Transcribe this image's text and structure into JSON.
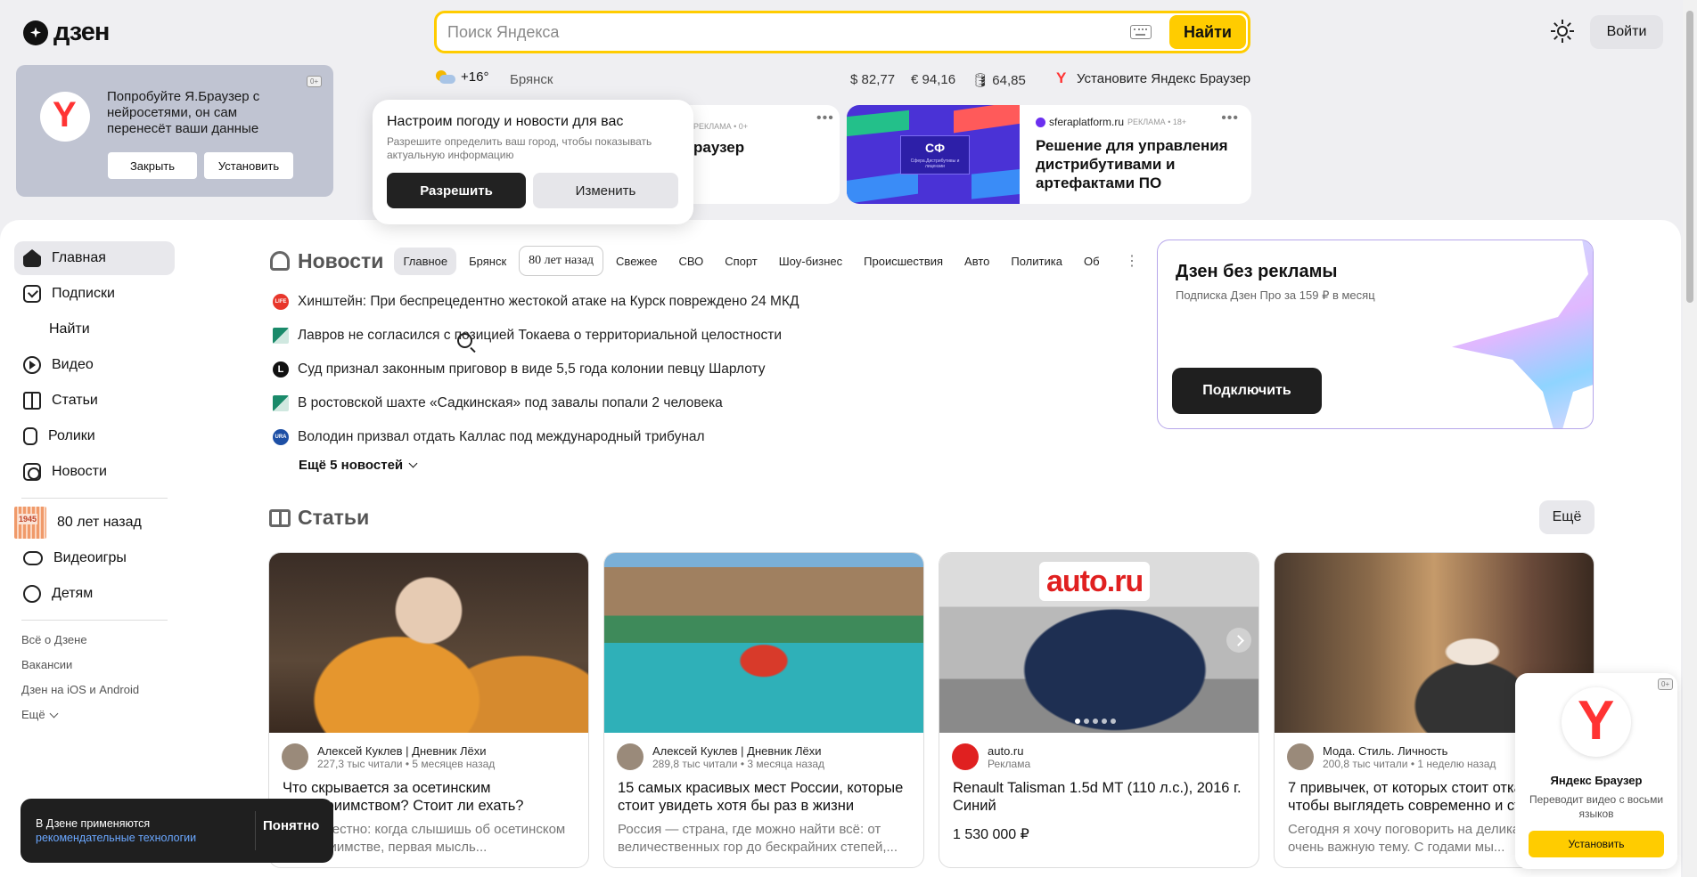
{
  "header": {
    "logo_text": "дзен",
    "search_placeholder": "Поиск Яндекса",
    "search_button": "Найти",
    "login_button": "Войти"
  },
  "info_bar": {
    "temperature": "+16°",
    "city": "Брянск",
    "usd": "$ 82,77",
    "eur": "€ 94,16",
    "oil": "🛢 64,85",
    "browser_promo": "Установите Яндекс Браузер"
  },
  "browser_promo": {
    "age": "0+",
    "text": "Попробуйте Я.Браузер с нейросетями, он сам перенесёт ваши данные",
    "close_button": "Закрыть",
    "install_button": "Установить"
  },
  "geo_popup": {
    "title": "Настроим погоду и новости для вас",
    "description": "Разрешите определить ваш город, чтобы показывать актуальную информацию",
    "allow_button": "Разрешить",
    "change_button": "Изменить"
  },
  "ads": [
    {
      "label": "РЕКЛАМА • 0+",
      "title": "раузер",
      "dots": "•••"
    },
    {
      "domain": "sferaplatform.ru",
      "label": "РЕКЛАМА • 18+",
      "title": "Решение для управления дистрибутивами и артефактами ПО",
      "image_logo": "СФ",
      "image_caption": "Сфера.Дистрибутивы и лицензии",
      "dots": "•••"
    }
  ],
  "sidebar": {
    "items": [
      {
        "label": "Главная",
        "icon": "home-icon"
      },
      {
        "label": "Подписки",
        "icon": "subscriptions-icon"
      },
      {
        "label": "Найти",
        "icon": "search-icon"
      },
      {
        "label": "Видео",
        "icon": "video-icon"
      },
      {
        "label": "Статьи",
        "icon": "articles-icon"
      },
      {
        "label": "Ролики",
        "icon": "shorts-icon"
      },
      {
        "label": "Новости",
        "icon": "news-icon"
      }
    ],
    "special": [
      {
        "label": "80 лет назад",
        "icon": "stamp-icon"
      },
      {
        "label": "Видеоигры",
        "icon": "gamepad-icon"
      },
      {
        "label": "Детям",
        "icon": "kids-icon"
      }
    ],
    "footer": [
      "Всё о Дзене",
      "Вакансии",
      "Дзен на iOS и Android"
    ],
    "more": "Ещё"
  },
  "news": {
    "title": "Новости",
    "tabs": [
      "Главное",
      "Брянск",
      "80 лет назад",
      "Свежее",
      "СВО",
      "Спорт",
      "Шоу-бизнес",
      "Происшествия",
      "Авто",
      "Политика",
      "Об"
    ],
    "items": [
      {
        "source": "LIFE",
        "text": "Хинштейн: При беспрецедентно жестокой атаке на Курск повреждено 24 МКД"
      },
      {
        "source": "",
        "text": "Лавров не согласился с позицией Токаева о территориальной целостности"
      },
      {
        "source": "L",
        "text": "Суд признал законным приговор в виде 5,5 года колонии певцу Шарлоту"
      },
      {
        "source": "",
        "text": "В ростовской шахте «Садкинская» под завалы попали 2 человека"
      },
      {
        "source": "URA RU",
        "text": "Володин призвал отдать Каллас под международный трибунал"
      }
    ],
    "more": "Ещё 5 новостей"
  },
  "premium": {
    "title": "Дзен без рекламы",
    "subtitle": "Подписка Дзен Про за 159 ₽ в месяц",
    "button": "Подключить"
  },
  "articles": {
    "title": "Статьи",
    "more_button": "Ещё",
    "cards": [
      {
        "author": "Алексей Куклев | Дневник Лёхи",
        "stats": "227,3 тыс читали • 5 месяцев назад",
        "title": "Что скрывается за осетинским гостеприимством? Стоит ли ехать?",
        "desc": "Скажу честно: когда слышишь об осетинском гостеприимстве, первая мысль..."
      },
      {
        "author": "Алексей Куклев | Дневник Лёхи",
        "stats": "289,8 тыс читали • 3 месяца назад",
        "title": "15 самых красивых мест России, которые стоит увидеть хотя бы раз в жизни",
        "desc": "Россия — страна, где можно найти всё: от величественных гор до бескрайних степей,..."
      },
      {
        "author": "auto.ru",
        "stats": "Реклама",
        "image_logo": "auto.ru",
        "title": "Renault Talisman 1.5d MT (110 л.с.), 2016 г. Синий",
        "price": "1 530 000 ₽"
      },
      {
        "author": "Мода. Стиль. Личность",
        "stats": "200,8 тыс читали • 1 неделю назад",
        "title": "7 привычек, от которых стоит отказаться, чтобы выглядеть современно и стильно",
        "desc": "Сегодня я хочу поговорить на деликатную, но очень важную тему. С годами мы..."
      }
    ]
  },
  "cookie": {
    "text": "В Дзене применяются",
    "link": "рекомендательные технологии",
    "button": "Понятно"
  },
  "yandex_browser_card": {
    "age": "0+",
    "name": "Яндекс Браузер",
    "subtitle": "Переводит видео с восьми языков",
    "install_button": "Установить"
  },
  "colors": {
    "accent_yellow": "#ffcc00",
    "dark": "#1f1f1f",
    "link": "#6aa7ff"
  }
}
